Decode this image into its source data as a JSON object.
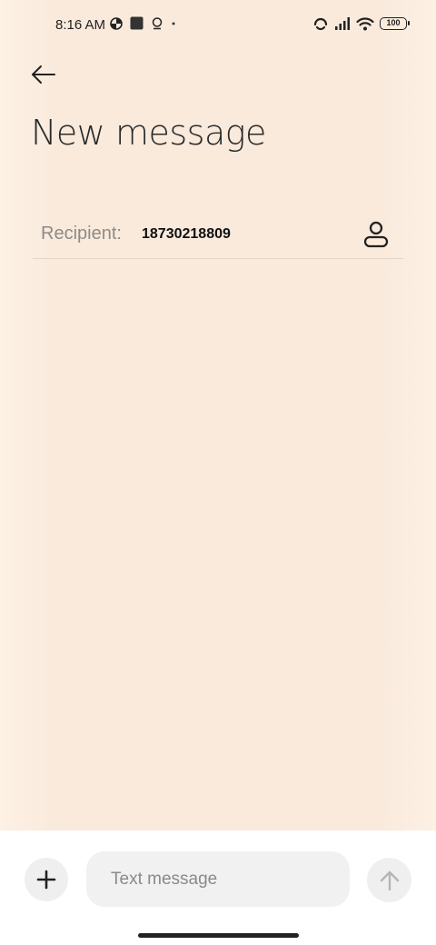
{
  "status_bar": {
    "time": "8:16 AM",
    "left_icons": [
      "location-pie-icon",
      "square-app-icon",
      "assistant-icon",
      "dot-icon"
    ],
    "right_icons": [
      "signal-loop-icon",
      "cellular-signal-icon",
      "wifi-icon"
    ],
    "battery": "100"
  },
  "header": {
    "back_icon": "arrow-left-icon",
    "title": "New message"
  },
  "recipient": {
    "label": "Recipient:",
    "value": "18730218809",
    "contact_icon": "person-icon"
  },
  "composer": {
    "add_icon": "plus-icon",
    "placeholder": "Text message",
    "send_icon": "arrow-up-icon"
  },
  "colors": {
    "background": "#f9eadc",
    "bottom_bar": "#ffffff",
    "input_bg": "#f1f1f1"
  }
}
